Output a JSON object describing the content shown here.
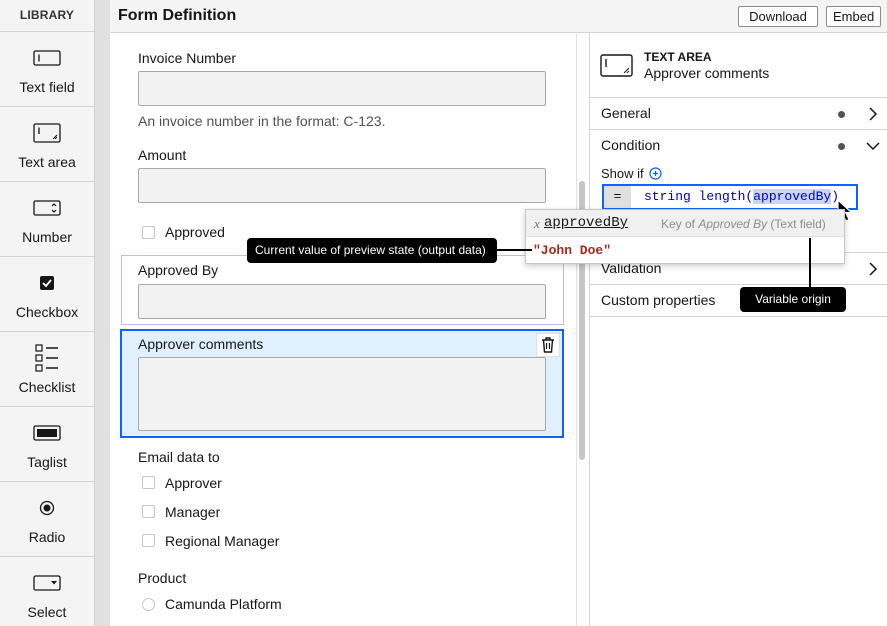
{
  "library": {
    "title": "LIBRARY",
    "items": [
      {
        "label": "Text field",
        "icon": "text-field-icon"
      },
      {
        "label": "Text area",
        "icon": "text-area-icon"
      },
      {
        "label": "Number",
        "icon": "number-icon"
      },
      {
        "label": "Checkbox",
        "icon": "checkbox-icon"
      },
      {
        "label": "Checklist",
        "icon": "checklist-icon"
      },
      {
        "label": "Taglist",
        "icon": "taglist-icon"
      },
      {
        "label": "Radio",
        "icon": "radio-icon"
      },
      {
        "label": "Select",
        "icon": "select-icon"
      }
    ]
  },
  "header": {
    "title": "Form Definition",
    "download_label": "Download",
    "embed_label": "Embed"
  },
  "form": {
    "invoice_label": "Invoice Number",
    "invoice_description": "An invoice number in the format: C-123.",
    "amount_label": "Amount",
    "approved_label": "Approved",
    "approved_by_label": "Approved By",
    "approver_comments_label": "Approver comments",
    "email_label": "Email data to",
    "email_options": [
      "Approver",
      "Manager",
      "Regional Manager"
    ],
    "product_label": "Product",
    "product_options": [
      "Camunda Platform"
    ]
  },
  "properties": {
    "type": "TEXT AREA",
    "name": "Approver comments",
    "sections": {
      "general": "General",
      "condition": "Condition",
      "validation": "Validation",
      "custom": "Custom properties"
    },
    "show_if_label": "Show if",
    "expression_eq": "=",
    "expression_prefix": "string length(",
    "expression_var": "approvedBy",
    "expression_suffix": ")"
  },
  "autocomplete": {
    "kind": "x",
    "var_name": "approvedBy",
    "desc_prefix": "Key of ",
    "desc_field": "Approved By",
    "desc_suffix": " (Text field)",
    "preview_value": "\"John Doe\""
  },
  "annotations": {
    "preview_state": "Current value of preview state (output data)",
    "variable_origin": "Variable origin"
  },
  "colors": {
    "accent": "#0f62fe",
    "selected_bg": "#e0f0ff",
    "preview_text": "#a8281e"
  }
}
